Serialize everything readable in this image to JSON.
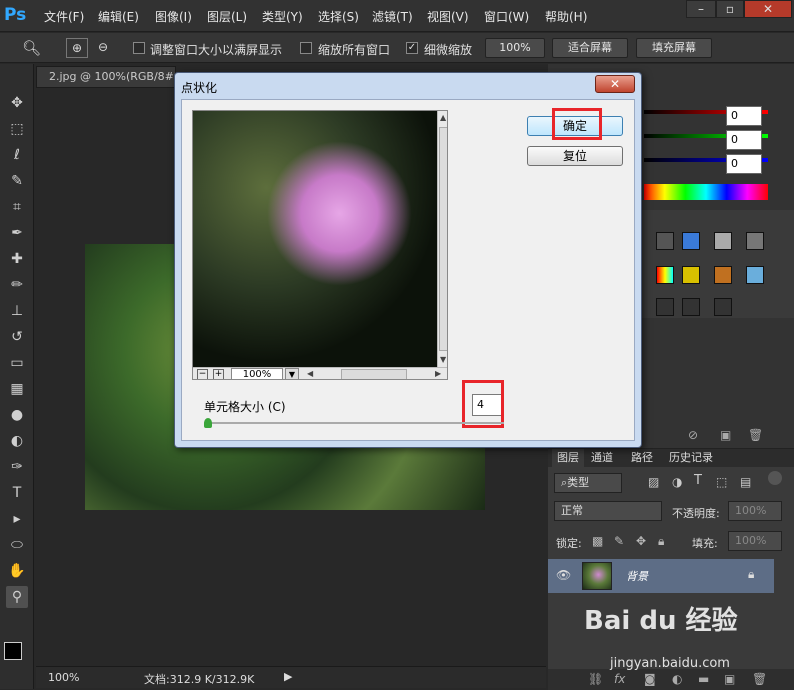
{
  "app": {
    "logo": "Ps"
  },
  "menu": [
    "文件(F)",
    "编辑(E)",
    "图像(I)",
    "图层(L)",
    "类型(Y)",
    "选择(S)",
    "滤镜(T)",
    "视图(V)",
    "窗口(W)",
    "帮助(H)"
  ],
  "window_controls": {
    "minimize": "–",
    "restore": "▫",
    "close": "✕"
  },
  "options": {
    "zoom_in_icon": "zoom-in-icon",
    "resize_window": "调整窗口大小以满屏显示",
    "zoom_all": "缩放所有窗口",
    "scrubby_zoom": "细微缩放",
    "scrubby_checked": true,
    "percent_btn": "100%",
    "fit_screen": "适合屏幕",
    "fill_screen": "填充屏幕"
  },
  "document": {
    "tab_title": "2.jpg @ 100%(RGB/8#)"
  },
  "status": {
    "zoom": "100%",
    "doc_info": "文档:312.9 K/312.9K"
  },
  "color_panel": {
    "r": "0",
    "g": "0",
    "b": "0"
  },
  "layers_panel": {
    "tabs": [
      "图层",
      "通道",
      "路径",
      "历史记录"
    ],
    "filter_type": "类型",
    "blend_mode": "正常",
    "opacity_label": "不透明度:",
    "opacity_value": "100%",
    "lock_label": "锁定:",
    "fill_label": "填充:",
    "fill_value": "100%",
    "layer_name": "背景"
  },
  "dialog": {
    "title": "点状化",
    "close": "✕",
    "ok": "确定",
    "reset": "复位",
    "zoom_value": "100%",
    "zoom_minus": "−",
    "zoom_plus": "+",
    "cell_size_label": "单元格大小 (C)",
    "cell_size_value": "4"
  },
  "watermark": {
    "text": "Bai du 经验",
    "url": "jingyan.baidu.com"
  }
}
